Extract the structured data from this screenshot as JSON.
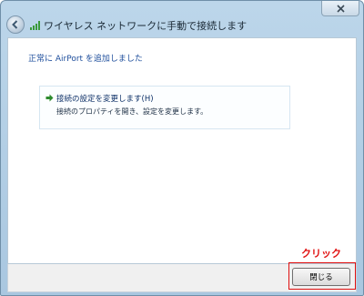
{
  "window": {
    "title": "ワイヤレス ネットワークに手動で接続します"
  },
  "content": {
    "headline": "正常に AirPort を追加しました",
    "option": {
      "title": "接続の設定を変更します(H)",
      "description": "接続のプロパティを開き、設定を変更します。"
    }
  },
  "footer": {
    "close_label": "閉じる"
  },
  "annotation": {
    "label": "クリック"
  },
  "colors": {
    "accent": "#1e4e9c",
    "annotation": "#e01010",
    "arrow": "#2e8b2e"
  }
}
